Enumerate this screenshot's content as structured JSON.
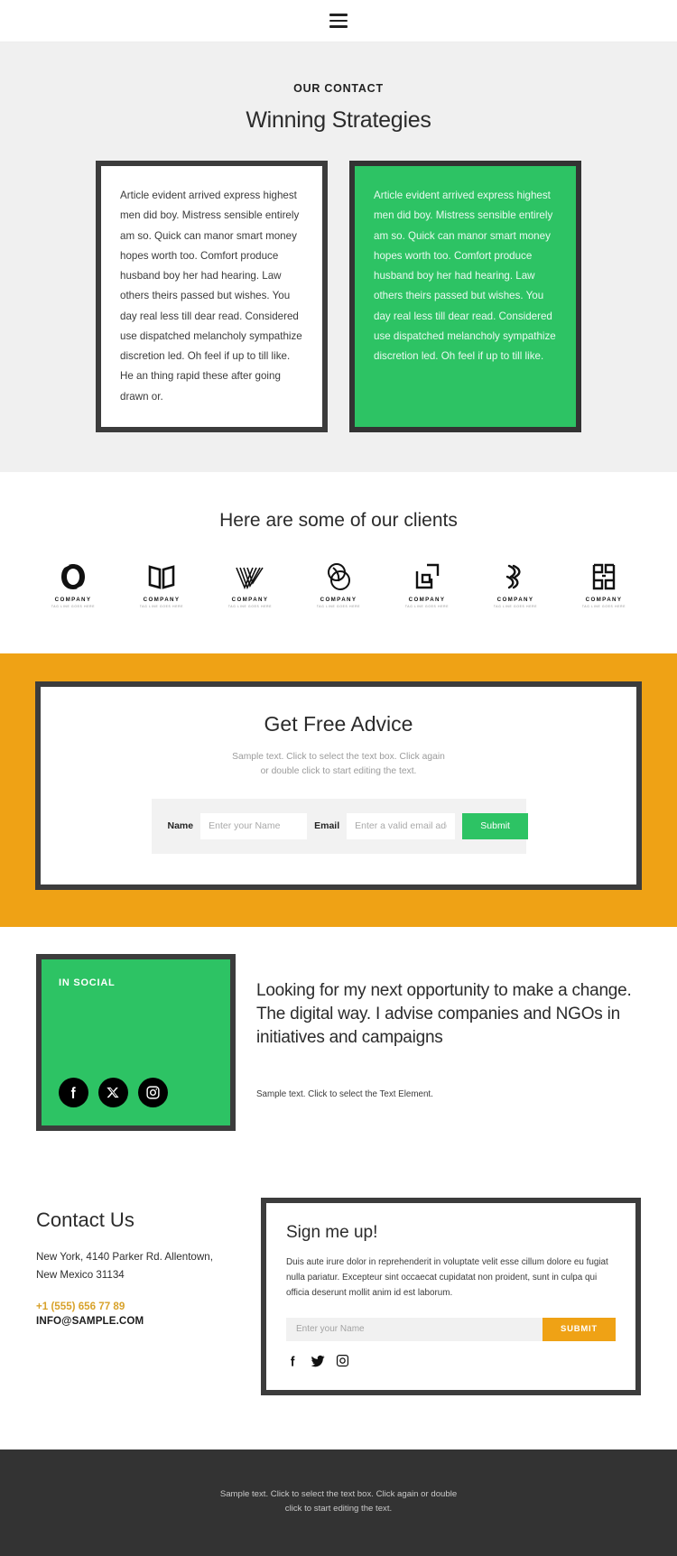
{
  "header": {
    "menu_icon": "hamburger-menu-icon"
  },
  "strategies": {
    "eyebrow": "OUR CONTACT",
    "title": "Winning Strategies",
    "card_light": "Article evident arrived express highest men did boy. Mistress sensible entirely am so. Quick can manor smart money hopes worth too. Comfort produce husband boy her had hearing. Law others theirs passed but wishes. You day real less till dear read. Considered use dispatched melancholy sympathize discretion led. Oh feel if up to till like. He an thing rapid these after going drawn or.",
    "card_green": "Article evident arrived express highest men did boy. Mistress sensible entirely am so. Quick can manor smart money hopes worth too. Comfort produce husband boy her had hearing. Law others theirs passed but wishes. You day real less till dear read. Considered use dispatched melancholy sympathize discretion led. Oh feel if up to till like."
  },
  "clients": {
    "title": "Here are some of our clients",
    "logos": [
      {
        "name": "COMPANY",
        "tagline": "TAG LINE GOES HERE",
        "mark": "oval-ring-logo"
      },
      {
        "name": "COMPANY",
        "tagline": "TAG LINE GOES HERE",
        "mark": "open-book-logo"
      },
      {
        "name": "COMPANY",
        "tagline": "TAG LINE GOES HERE",
        "mark": "striped-v-logo"
      },
      {
        "name": "COMPANY",
        "tagline": "TAG LINE GOES HERE",
        "mark": "overlapping-circles-logo"
      },
      {
        "name": "COMPANY",
        "tagline": "TAG LINE GOES HERE",
        "mark": "nested-squares-logo"
      },
      {
        "name": "COMPANY",
        "tagline": "TAG LINE GOES HERE",
        "mark": "slanted-strokes-logo"
      },
      {
        "name": "COMPANY",
        "tagline": "TAG LINE GOES HERE",
        "mark": "double-bracket-logo"
      }
    ]
  },
  "advice": {
    "title": "Get Free Advice",
    "subtitle_line1": "Sample text. Click to select the text box. Click again",
    "subtitle_line2": "or double click to start editing the text.",
    "name_label": "Name",
    "name_placeholder": "Enter your Name",
    "name_value": "",
    "email_label": "Email",
    "email_placeholder": "Enter a valid email address",
    "email_value": "",
    "submit_label": "Submit"
  },
  "social": {
    "badge": "IN SOCIAL",
    "icons": [
      "facebook-icon",
      "x-twitter-icon",
      "instagram-icon"
    ],
    "headline": "Looking for my next opportunity to make a change. The digital way. I advise companies and NGOs in initiatives and campaigns",
    "caption": "Sample text. Click to select the Text Element."
  },
  "contact": {
    "title": "Contact Us",
    "address_line1": "New York, 4140 Parker Rd. Allentown,",
    "address_line2": "New Mexico 31134",
    "phone": "+1 (555) 656 77 89",
    "email": "INFO@SAMPLE.COM"
  },
  "signup": {
    "title": "Sign me up!",
    "body": "Duis aute irure dolor in reprehenderit in voluptate velit esse cillum dolore eu fugiat nulla pariatur. Excepteur sint occaecat cupidatat non proident, sunt in culpa qui officia deserunt mollit anim id est laborum.",
    "name_placeholder": "Enter your Name",
    "name_value": "",
    "submit_label": "SUBMIT",
    "icons": [
      "facebook-icon",
      "twitter-bird-icon",
      "instagram-icon"
    ]
  },
  "footer": {
    "line1": "Sample text. Click to select the text box. Click again or double",
    "line2": "click to start editing the text."
  },
  "colors": {
    "green": "#2dc364",
    "orange": "#efa215",
    "dark_border": "#3c3c3c",
    "footer_bg": "#333333",
    "section_bg": "#f0f0f0",
    "phone_gold": "#d8a22b"
  }
}
